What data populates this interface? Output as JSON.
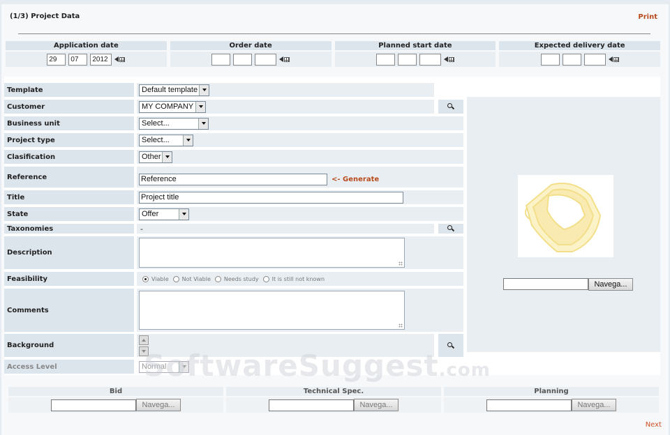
{
  "header": {
    "title": "(1/3) Project Data",
    "print_label": "Print"
  },
  "dates": [
    {
      "label": "Application date",
      "day": "29",
      "month": "07",
      "year": "2012"
    },
    {
      "label": "Order date",
      "day": "",
      "month": "",
      "year": ""
    },
    {
      "label": "Planned start date",
      "day": "",
      "month": "",
      "year": ""
    },
    {
      "label": "Expected delivery date",
      "day": "",
      "month": "",
      "year": ""
    }
  ],
  "form": {
    "template": {
      "label": "Template",
      "value": "Default template"
    },
    "customer": {
      "label": "Customer",
      "value": "MY COMPANY"
    },
    "business_unit": {
      "label": "Business unit",
      "value": "Select..."
    },
    "project_type": {
      "label": "Project type",
      "value": "Select..."
    },
    "classification": {
      "label": "Clasification",
      "value": "Other"
    },
    "reference": {
      "label": "Reference",
      "value": "Reference",
      "generate_label": "<- Generate"
    },
    "title": {
      "label": "Title",
      "value": "Project title"
    },
    "state": {
      "label": "State",
      "value": "Offer"
    },
    "taxonomies": {
      "label": "Taxonomies",
      "value": "-"
    },
    "description": {
      "label": "Description",
      "value": ""
    },
    "feasibility": {
      "label": "Feasibility",
      "options": [
        "Viable",
        "Not Viable",
        "Needs study",
        "It is still not known"
      ],
      "selected": "Viable"
    },
    "comments": {
      "label": "Comments",
      "value": ""
    },
    "background": {
      "label": "Background"
    },
    "access_level": {
      "label": "Access Level",
      "value": "Normal"
    }
  },
  "image_panel": {
    "browse_label": "Navega..."
  },
  "attachments": [
    {
      "label": "Bid",
      "browse_label": "Navega..."
    },
    {
      "label": "Technical Spec.",
      "browse_label": "Navega..."
    },
    {
      "label": "Planning",
      "browse_label": "Navega..."
    }
  ],
  "watermark": {
    "main": "SoftwareSuggest",
    "suffix": ".com"
  },
  "footer": {
    "next_label": "Next"
  },
  "colors": {
    "accent": "#b84a1c",
    "label_bg": "#dde5ec",
    "field_bg": "#e9eef2",
    "logo": "#f6e7a0"
  },
  "icons": [
    "calendar-icon",
    "search-icon",
    "spinner-icon"
  ]
}
